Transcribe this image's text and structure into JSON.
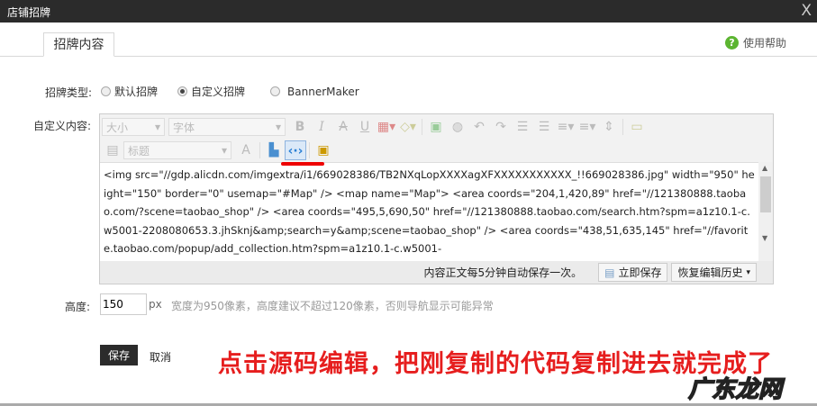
{
  "window": {
    "title": "店铺招牌",
    "close": "X"
  },
  "tab": {
    "label": "招牌内容"
  },
  "help": {
    "icon": "?",
    "label": "使用帮助"
  },
  "type": {
    "label": "招牌类型:",
    "options": [
      {
        "label": "默认招牌",
        "selected": false
      },
      {
        "label": "自定义招牌",
        "selected": true
      },
      {
        "label": "BannerMaker",
        "selected": false
      }
    ]
  },
  "content": {
    "label": "自定义内容:"
  },
  "toolbar": {
    "size": "大小",
    "font": "字体",
    "heading": "标题",
    "bold": "B",
    "italic": "I",
    "strike": "A",
    "underline": "U"
  },
  "editor": {
    "code": "<img src=\"//gdp.alicdn.com/imgextra/i1/669028386/TB2NXqLopXXXXagXFXXXXXXXXXXX_!!669028386.jpg\" width=\"950\" height=\"150\" border=\"0\" usemap=\"#Map\" /> <map name=\"Map\"> <area coords=\"204,1,420,89\" href=\"//121380888.taobao.com/?scene=taobao_shop\" /> <area coords=\"495,5,690,50\" href=\"//121380888.taobao.com/search.htm?spm=a1z10.1-c.w5001-2208080653.3.jhSknj&amp;search=y&amp;scene=taobao_shop\" /> <area coords=\"438,51,635,145\" href=\"//favorite.taobao.com/popup/add_collection.htm?spm=a1z10.1-c.w5001-",
    "autosave": "内容正文每5分钟自动保存一次。",
    "save_now": "立即保存",
    "restore": "恢复编辑历史"
  },
  "height": {
    "label": "高度:",
    "value": "150",
    "unit": "px",
    "hint": "宽度为950像素，高度建议不超过120像素，否则导航显示可能异常"
  },
  "actions": {
    "save": "保存",
    "cancel": "取消"
  },
  "annotation": "点击源码编辑，把刚复制的代码复制进去就完成了",
  "watermark": "广东龙网"
}
